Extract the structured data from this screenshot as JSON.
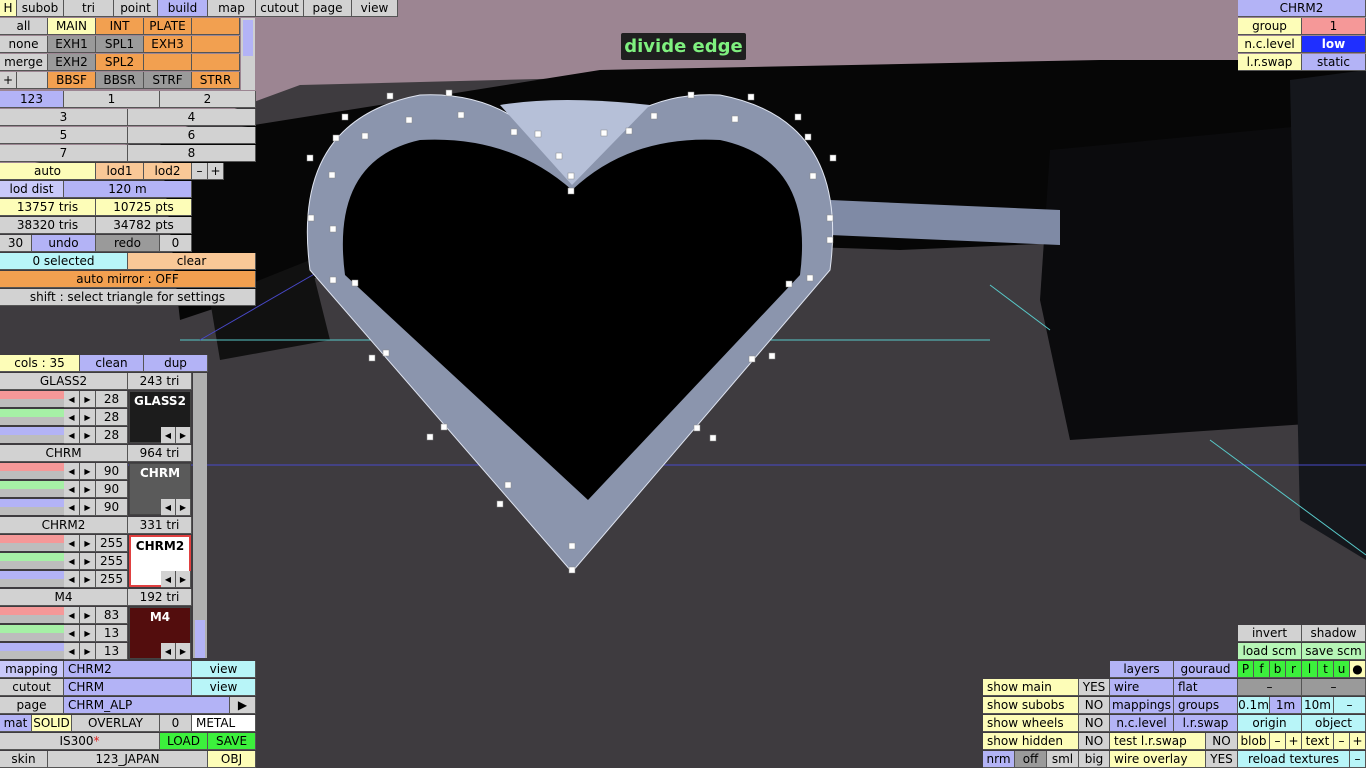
{
  "viewport_title": "divide edge",
  "top_menu": {
    "h": "H",
    "items": [
      "subob",
      "tri",
      "point",
      "build",
      "map",
      "cutout",
      "page",
      "view"
    ]
  },
  "groups_panel": {
    "row1": [
      "all",
      "MAIN",
      "INT",
      "PLATE",
      ""
    ],
    "row2": [
      "none",
      "EXH1",
      "SPL1",
      "EXH3",
      ""
    ],
    "row3": [
      "merge",
      "EXH2",
      "SPL2",
      "",
      ""
    ],
    "row4": [
      "+",
      "",
      "BBSF",
      "BBSR",
      "STRF",
      "STRR"
    ]
  },
  "lod_levels": {
    "row1": [
      "123",
      "1",
      "2"
    ],
    "row2": [
      "3",
      "4"
    ],
    "row3": [
      "5",
      "6"
    ],
    "row4": [
      "7",
      "8"
    ]
  },
  "lod": {
    "auto": "auto",
    "lod1": "lod1",
    "lod2": "lod2",
    "minus": "–",
    "plus": "+",
    "dist_label": "lod dist",
    "dist_value": "120 m"
  },
  "stats": {
    "tris1": "13757 tris",
    "pts1": "10725 pts",
    "tris2": "38320 tris",
    "pts2": "34782 pts"
  },
  "undo": {
    "count": "30",
    "undo": "undo",
    "redo": "redo",
    "redo_count": "0"
  },
  "selection": {
    "selected": "0 selected",
    "clear": "clear",
    "mirror": "auto mirror : OFF",
    "hint": "shift : select triangle for settings"
  },
  "materials_header": {
    "cols": "cols : 35",
    "clean": "clean",
    "dup": "dup"
  },
  "materials": [
    {
      "name": "GLASS2",
      "tris": "243 tri",
      "r": "28",
      "g": "28",
      "b": "28",
      "swatch_label": "GLASS2",
      "swatch_color": "#1c1c1c",
      "text_color": "#ffffff"
    },
    {
      "name": "CHRM",
      "tris": "964 tri",
      "r": "90",
      "g": "90",
      "b": "90",
      "swatch_label": "CHRM",
      "swatch_color": "#5a5a5a",
      "text_color": "#ffffff"
    },
    {
      "name": "CHRM2",
      "tris": "331 tri",
      "r": "255",
      "g": "255",
      "b": "255",
      "swatch_label": "CHRM2",
      "swatch_color": "#ffffff",
      "text_color": "#000000"
    },
    {
      "name": "M4",
      "tris": "192 tri",
      "r": "83",
      "g": "13",
      "b": "13",
      "swatch_label": "M4",
      "swatch_color": "#530d0d",
      "text_color": "#ffffff"
    }
  ],
  "bottom_left": {
    "mapping_label": "mapping",
    "mapping_value": "CHRM2",
    "mapping_view": "view",
    "cutout_label": "cutout",
    "cutout_value": "CHRM",
    "cutout_view": "view",
    "page_label": "page",
    "page_value": "CHRM_ALP",
    "page_arrow": "▶",
    "mat_label": "mat",
    "solid": "SOLID",
    "overlay": "OVERLAY",
    "zero": "0",
    "metal": "METAL",
    "car": "IS300",
    "car_mark": "*",
    "load": "LOAD",
    "save": "SAVE",
    "skin_label": "skin",
    "skin_value": "123_JAPAN",
    "obj": "OBJ"
  },
  "top_right": {
    "title": "CHRM2",
    "group_label": "group",
    "group_value": "1",
    "nc_label": "n.c.level",
    "nc_value": "low",
    "lr_label": "l.r.swap",
    "lr_value": "static"
  },
  "bottom_right": {
    "invert": "invert",
    "shadow": "shadow",
    "load_scm": "load scm",
    "save_scm": "save scm",
    "layers": "layers",
    "gouraud": "gouraud",
    "pfbrltu": [
      "P",
      "f",
      "b",
      "r",
      "l",
      "t",
      "u"
    ],
    "dot": "●",
    "wire": "wire",
    "flat": "flat",
    "dash": "–",
    "show_main": "show main",
    "show_main_v": "YES",
    "show_subobs": "show subobs",
    "show_subobs_v": "NO",
    "show_wheels": "show wheels",
    "show_wheels_v": "NO",
    "show_hidden": "show hidden",
    "show_hidden_v": "NO",
    "mappings": "mappings",
    "groups": "groups",
    "d01": "0.1m",
    "d1": "1m",
    "d10": "10m",
    "nclevel": "n.c.level",
    "lrswap": "l.r.swap",
    "origin": "origin",
    "object": "object",
    "test_lr": "test l.r.swap",
    "test_lr_v": "NO",
    "blob": "blob",
    "text": "text",
    "nrm": "nrm",
    "off": "off",
    "sml": "sml",
    "big": "big",
    "wire_overlay": "wire overlay",
    "wire_overlay_v": "YES",
    "reload": "reload textures"
  }
}
